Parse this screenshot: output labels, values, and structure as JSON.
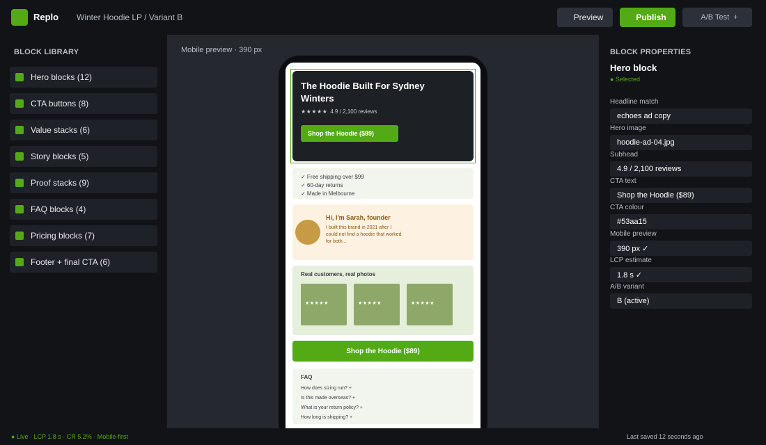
{
  "app": {
    "name": "Replo",
    "breadcrumb": "Winter Hoodie LP / Variant B",
    "accent": "#53aa15"
  },
  "toolbar": {
    "preview": "Preview",
    "publish": "Publish",
    "ab_test": "A/B Test",
    "ab_plus": "+"
  },
  "library": {
    "title": "BLOCK LIBRARY",
    "items": [
      {
        "label": "Hero blocks (12)"
      },
      {
        "label": "CTA buttons (8)"
      },
      {
        "label": "Value stacks (6)"
      },
      {
        "label": "Story blocks (5)"
      },
      {
        "label": "Proof stacks (9)"
      },
      {
        "label": "FAQ blocks (4)"
      },
      {
        "label": "Pricing blocks (7)"
      },
      {
        "label": "Footer + final CTA (6)"
      }
    ]
  },
  "canvas": {
    "label": "Mobile preview · 390 px",
    "hero": {
      "title": "The Hoodie Built For Sydney Winters",
      "stars": "★★★★★",
      "rating": "4.9 / 2,100 reviews",
      "cta": "Shop the Hoodie ($89)"
    },
    "values": [
      "✓ Free shipping over $99",
      "✓ 60-day returns",
      "✓ Made in Melbourne"
    ],
    "story": {
      "title": "Hi, I'm Sarah, founder",
      "body": "I built this brand in 2021 after I could not find a hoodie that worked for both..."
    },
    "proof": {
      "title": "Real customers, real photos",
      "photos": [
        "★★★★★",
        "★★★★★",
        "★★★★★"
      ]
    },
    "cta": "Shop the Hoodie ($89)",
    "faq": {
      "title": "FAQ",
      "questions": [
        "How does sizing run?  +",
        "Is this made overseas?  +",
        "What is your return policy?  +",
        "How long is shipping?  +"
      ]
    }
  },
  "properties": {
    "title": "BLOCK PROPERTIES",
    "block_name": "Hero block",
    "status": "● Selected",
    "fields": [
      {
        "label": "Headline match",
        "value": "echoes ad copy"
      },
      {
        "label": "Hero image",
        "value": "hoodie-ad-04.jpg"
      },
      {
        "label": "Subhead",
        "value": "4.9 / 2,100 reviews"
      },
      {
        "label": "CTA text",
        "value": "Shop the Hoodie ($89)"
      },
      {
        "label": "CTA colour",
        "value": "#53aa15"
      },
      {
        "label": "Mobile preview",
        "value": "390 px ✓"
      },
      {
        "label": "LCP estimate",
        "value": "1.8 s ✓"
      },
      {
        "label": "A/B variant",
        "value": "B (active)"
      }
    ]
  },
  "status": {
    "left": "● Live · LCP 1.8 s · CR 5.2% · Mobile-first",
    "right": "Last saved 12 seconds ago"
  }
}
